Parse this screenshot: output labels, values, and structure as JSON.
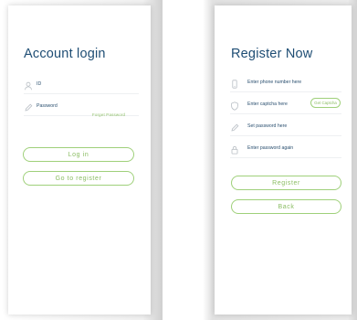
{
  "login": {
    "title": "Account login",
    "username_placeholder": "ID",
    "password_placeholder": "Password",
    "forgot_link": "Forget Password",
    "login_button": "Log in",
    "register_button": "Go to register"
  },
  "register": {
    "title": "Register Now",
    "phone_placeholder": "Enter phone number here",
    "captcha_placeholder": "Enter captcha here",
    "captcha_button": "Get Captcha",
    "password_placeholder": "Set password here",
    "password_again_placeholder": "Enter password again",
    "register_button": "Register",
    "back_button": "Back"
  },
  "colors": {
    "title": "#1e4d74",
    "accent_green": "#8bbd63",
    "icon_gray": "#b8bec4"
  },
  "icons": [
    "user-icon",
    "pen-icon",
    "phone-icon",
    "shield-icon",
    "pen-icon",
    "lock-icon"
  ]
}
